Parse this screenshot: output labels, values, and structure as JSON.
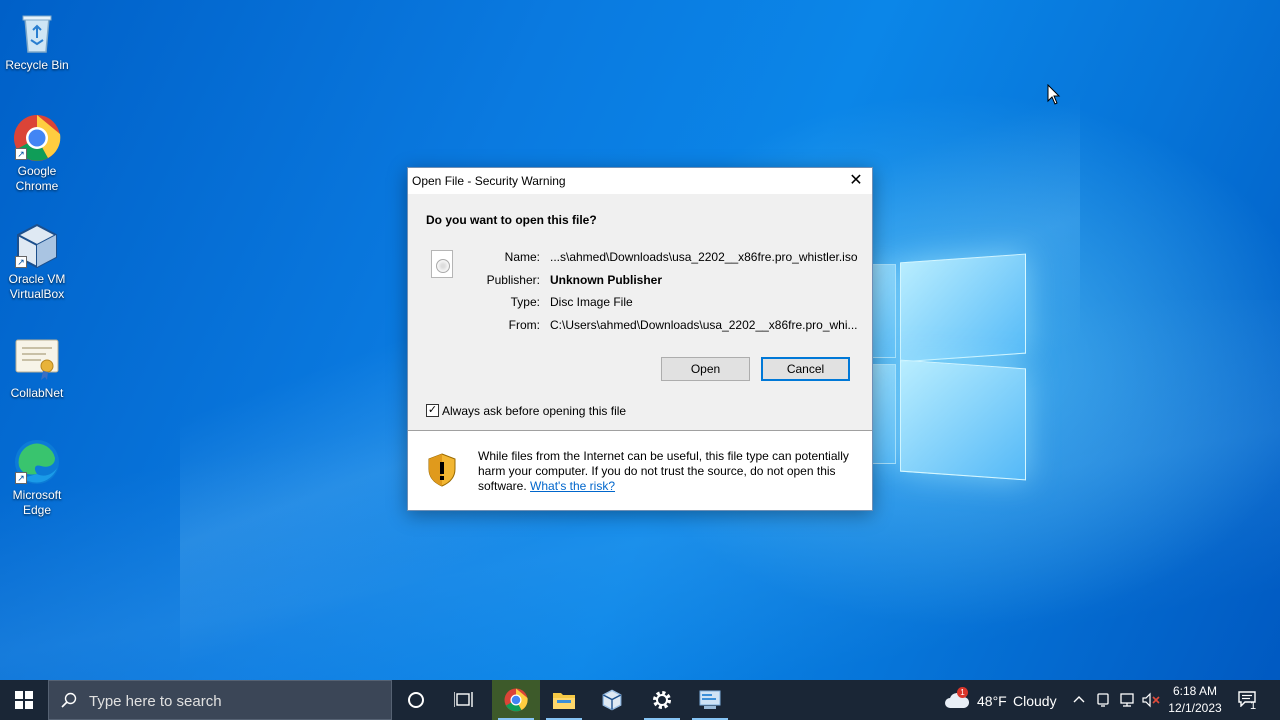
{
  "desktop": {
    "icons": [
      {
        "label_line1": "Recycle Bin",
        "label_line2": ""
      },
      {
        "label_line1": "Google",
        "label_line2": "Chrome"
      },
      {
        "label_line1": "Oracle VM",
        "label_line2": "VirtualBox"
      },
      {
        "label_line1": "CollabNet",
        "label_line2": ""
      },
      {
        "label_line1": "Microsoft",
        "label_line2": "Edge"
      }
    ]
  },
  "dialog": {
    "title": "Open File - Security Warning",
    "close_glyph": "✕",
    "question": "Do you want to open this file?",
    "fields": {
      "name_label": "Name:",
      "name_value": "...s\\ahmed\\Downloads\\usa_2202__x86fre.pro_whistler.iso",
      "publisher_label": "Publisher:",
      "publisher_value": "Unknown Publisher",
      "type_label": "Type:",
      "type_value": "Disc Image File",
      "from_label": "From:",
      "from_value": "C:\\Users\\ahmed\\Downloads\\usa_2202__x86fre.pro_whi..."
    },
    "open_button": "Open",
    "cancel_button": "Cancel",
    "checkbox_checked": true,
    "checkbox_mark": "✓",
    "checkbox_label": "Always ask before opening this file",
    "warning_text": "While files from the Internet can be useful, this file type can potentially harm your computer. If you do not trust the source, do not open this software.",
    "risk_link": "What's the risk?"
  },
  "taskbar": {
    "search_placeholder": "Type here to search",
    "weather_temp": "48°F",
    "weather_desc": "Cloudy",
    "weather_badge": "1",
    "time": "6:18 AM",
    "date": "12/1/2023",
    "notification_badge": "1"
  },
  "colors": {
    "accent": "#0078d7",
    "taskbar": "#1a2636",
    "link": "#0066cc"
  }
}
